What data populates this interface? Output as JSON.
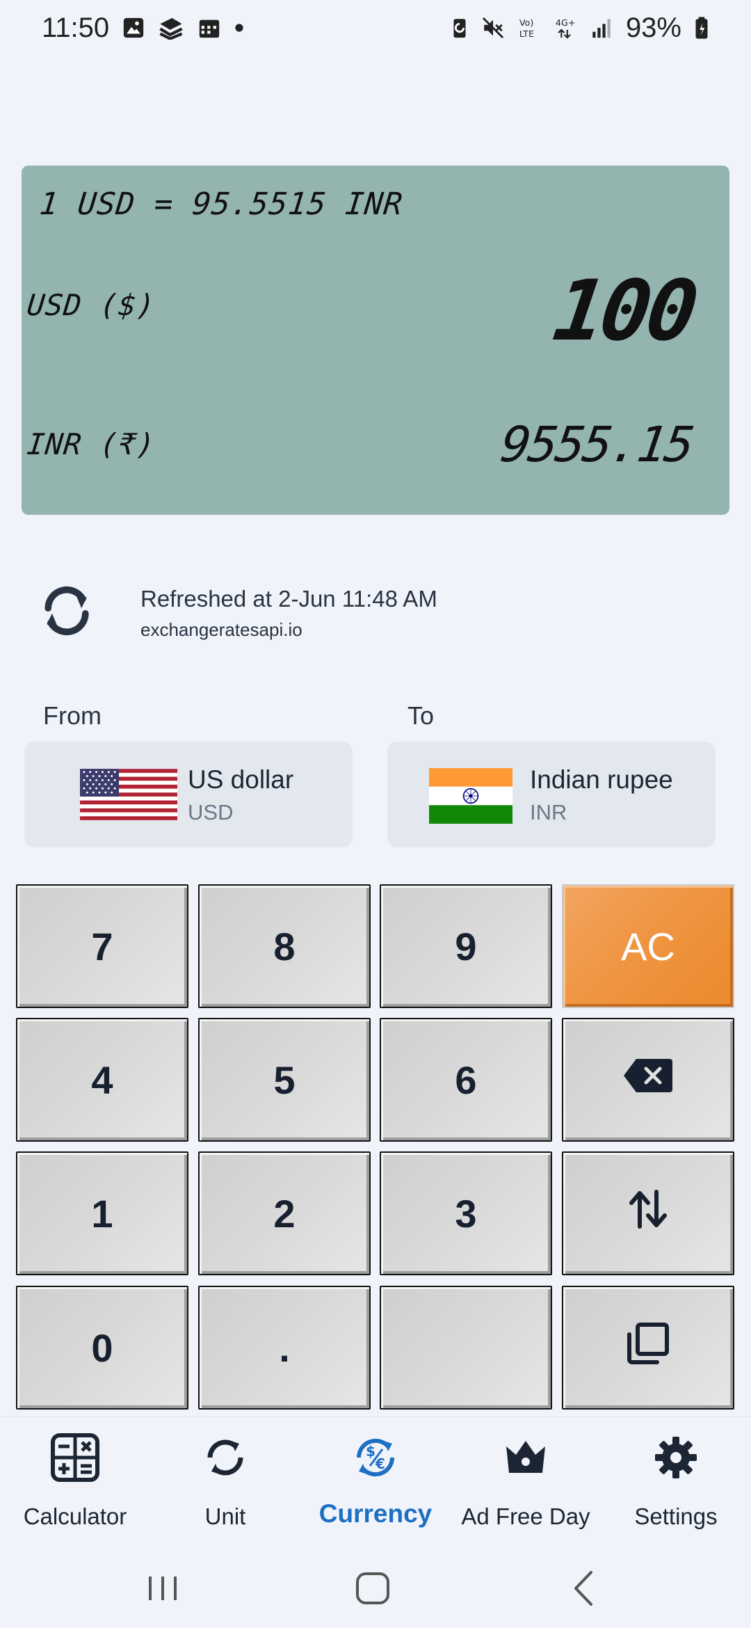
{
  "status_bar": {
    "time": "11:50",
    "battery": "93%"
  },
  "display": {
    "rate": "1 USD = 95.5515 INR",
    "from_label": "USD ($)",
    "from_value": "100",
    "to_label": "INR (₹)",
    "to_value": "9555.15"
  },
  "refresh": {
    "text": "Refreshed at 2-Jun 11:48 AM",
    "source": "exchangeratesapi.io"
  },
  "from": {
    "label": "From",
    "name": "US dollar",
    "code": "USD"
  },
  "to": {
    "label": "To",
    "name": "Indian rupee",
    "code": "INR"
  },
  "keypad": {
    "k7": "7",
    "k8": "8",
    "k9": "9",
    "ac": "AC",
    "k4": "4",
    "k5": "5",
    "k6": "6",
    "k1": "1",
    "k2": "2",
    "k3": "3",
    "k0": "0",
    "dot": "."
  },
  "nav": {
    "calculator": "Calculator",
    "unit": "Unit",
    "currency": "Currency",
    "ad_free": "Ad Free Day",
    "settings": "Settings"
  },
  "colors": {
    "accent": "#1e6fc4",
    "lcd": "#94b4b0",
    "ac_key": "#ef9440"
  }
}
